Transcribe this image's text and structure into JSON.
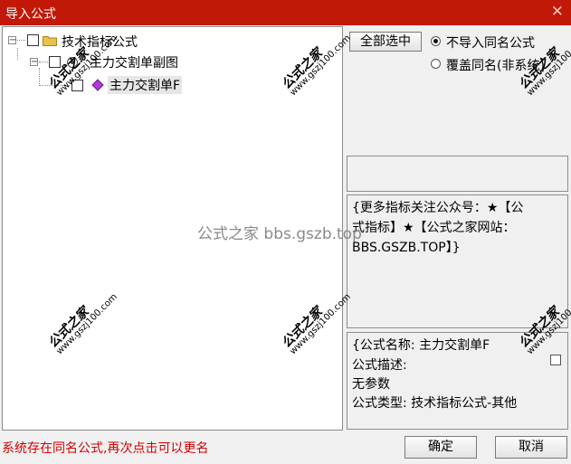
{
  "window": {
    "title": "导入公式",
    "close_glyph": "✕"
  },
  "tree": {
    "root_label": "技术指标公式",
    "child_label": "主力交割单副图",
    "leaf_label": "主力交割单F",
    "expander_glyph": "⊟"
  },
  "options": {
    "select_all_label": "全部选中",
    "radio_skip_label": "不导入同名公式",
    "radio_overwrite_label": "覆盖同名(非系统)",
    "selected_option": "skip"
  },
  "info_panel": {
    "line1": "{更多指标关注公众号：★【公",
    "line2": "式指标】★【公式之家网站：",
    "line3": "BBS.GSZB.TOP】}"
  },
  "detail_panel": {
    "line1": "{公式名称: 主力交割单F",
    "line2": "公式描述:",
    "line3": "无参数",
    "line4": "公式类型: 技术指标公式-其他"
  },
  "footer": {
    "status_text": "系统存在同名公式,再次点击可以更名",
    "ok_label": "确定",
    "cancel_label": "取消"
  },
  "watermark": {
    "center_text": "公式之家 bbs.gszb.top",
    "stamp_big": "公式之家",
    "stamp_small": "www.gszj100.com"
  },
  "colors": {
    "titlebar": "#c21808",
    "status": "#d40000",
    "folder": "#e8c24a",
    "diamond": "#b23ad6"
  }
}
